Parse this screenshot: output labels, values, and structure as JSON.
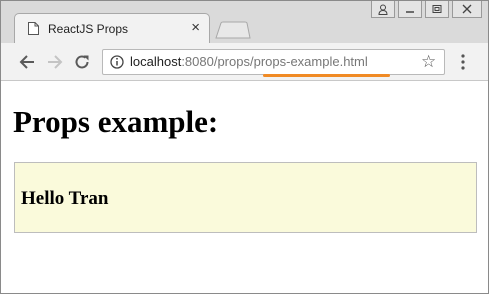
{
  "browser": {
    "tab": {
      "title": "ReactJS Props",
      "close_glyph": "×",
      "icon": "page-icon"
    },
    "window_controls": [
      "user-icon",
      "minimize-icon",
      "restore-icon",
      "close-icon"
    ],
    "toolbar": {
      "back_icon": "back-arrow-icon",
      "forward_icon": "forward-arrow-icon",
      "reload_icon": "reload-icon",
      "url": {
        "host": "localhost",
        "port_path": ":8080/props/",
        "file": "props-example.html"
      },
      "star_glyph": "☆",
      "menu_icon": "more-vertical-icon"
    },
    "accent_color": "#f08a24"
  },
  "page": {
    "heading": "Props example:",
    "greeting": "Hello Tran",
    "greeting_box_color": "#fafadb"
  }
}
